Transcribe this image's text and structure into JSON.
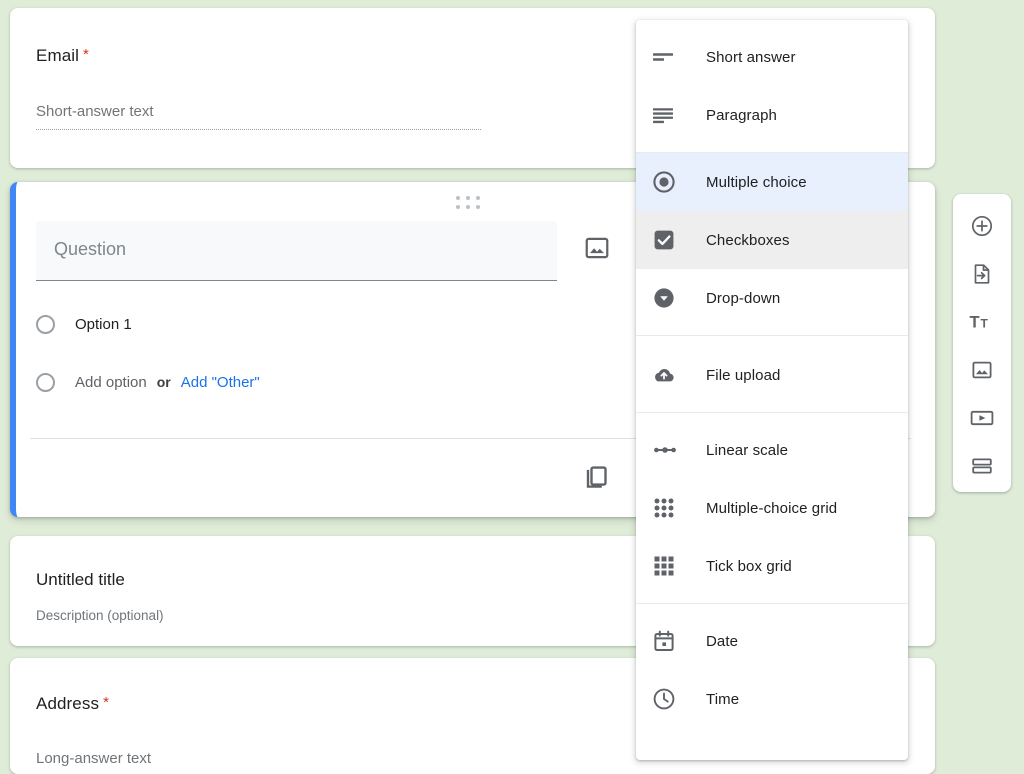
{
  "theme": {
    "background": "#dfecd8",
    "card_background": "#ffffff",
    "accent_blue": "#4285f4",
    "link_blue": "#1a73e8",
    "selected_row_background": "#e8f0fe",
    "hovered_row_background": "#eeeeee",
    "required_star_color": "#d93025",
    "icon_gray": "#5f6368"
  },
  "form": {
    "cards": [
      {
        "id": "email",
        "title": "Email",
        "required": true,
        "required_marker": "*",
        "answer_hint": "Short-answer text"
      },
      {
        "id": "untitled-section",
        "title": "Untitled title",
        "description": "Description (optional)"
      },
      {
        "id": "address",
        "title": "Address",
        "required": true,
        "required_marker": "*",
        "answer_hint": "Long-answer text"
      }
    ],
    "active_question": {
      "question_placeholder": "Question",
      "drag_handle": "drag-handle",
      "add_image_icon": "image-icon",
      "duplicate_icon": "duplicate-icon",
      "options": [
        {
          "label": "Option 1",
          "kind": "option"
        }
      ],
      "add_option_label": "Add option",
      "or_label": "or",
      "add_other_label": "Add \"Other\""
    }
  },
  "toolbar": {
    "buttons": [
      {
        "name": "add-question-button",
        "icon": "plus-circle-icon"
      },
      {
        "name": "import-questions-button",
        "icon": "import-file-icon"
      },
      {
        "name": "add-title-button",
        "icon": "title-text-icon"
      },
      {
        "name": "add-image-button",
        "icon": "image-icon"
      },
      {
        "name": "add-video-button",
        "icon": "video-icon"
      },
      {
        "name": "add-section-button",
        "icon": "section-icon"
      }
    ]
  },
  "type_menu": {
    "groups": [
      {
        "items": [
          {
            "label": "Short answer",
            "icon": "short-answer-icon",
            "state": "normal"
          },
          {
            "label": "Paragraph",
            "icon": "paragraph-icon",
            "state": "normal"
          }
        ]
      },
      {
        "items": [
          {
            "label": "Multiple choice",
            "icon": "radio-button-icon",
            "state": "selected"
          },
          {
            "label": "Checkboxes",
            "icon": "checkbox-icon",
            "state": "hovered"
          },
          {
            "label": "Drop-down",
            "icon": "dropdown-circle-icon",
            "state": "normal"
          }
        ]
      },
      {
        "items": [
          {
            "label": "File upload",
            "icon": "cloud-upload-icon",
            "state": "normal"
          }
        ]
      },
      {
        "items": [
          {
            "label": "Linear scale",
            "icon": "linear-scale-icon",
            "state": "normal"
          },
          {
            "label": "Multiple-choice grid",
            "icon": "radio-grid-icon",
            "state": "normal"
          },
          {
            "label": "Tick box grid",
            "icon": "checkbox-grid-icon",
            "state": "normal"
          }
        ]
      },
      {
        "items": [
          {
            "label": "Date",
            "icon": "calendar-icon",
            "state": "normal"
          },
          {
            "label": "Time",
            "icon": "clock-icon",
            "state": "normal"
          }
        ]
      }
    ]
  }
}
